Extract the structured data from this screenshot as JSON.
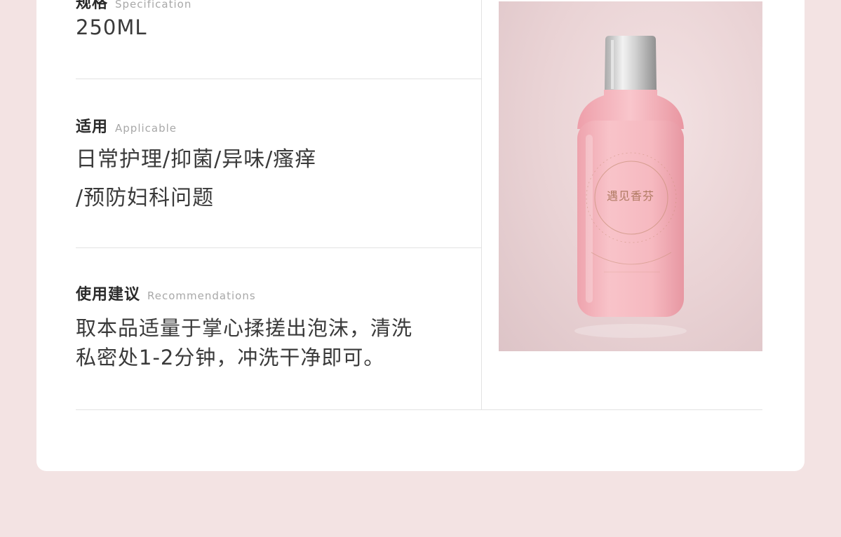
{
  "spec": {
    "label_cn": "规格",
    "label_en": "Specification",
    "value": "250ML"
  },
  "applicable": {
    "label_cn": "适用",
    "label_en": "Applicable",
    "line1": "日常护理/抑菌/异味/瘙痒",
    "line2": "/预防妇科问题"
  },
  "usage": {
    "label_cn": "使用建议",
    "label_en": "Recommendations",
    "line1": "取本品适量于掌心揉搓出泡沫，清洗",
    "line2": "私密处1-2分钟，冲洗干净即可。"
  },
  "product_image": {
    "brand_text": "遇见香芬"
  },
  "colors": {
    "page_bg": "#f3e3e3",
    "card_bg": "#ffffff",
    "bottle_pink": "#f5b8bf",
    "cap_silver": "#d9d9d9",
    "accent_gold": "#b07a62"
  }
}
